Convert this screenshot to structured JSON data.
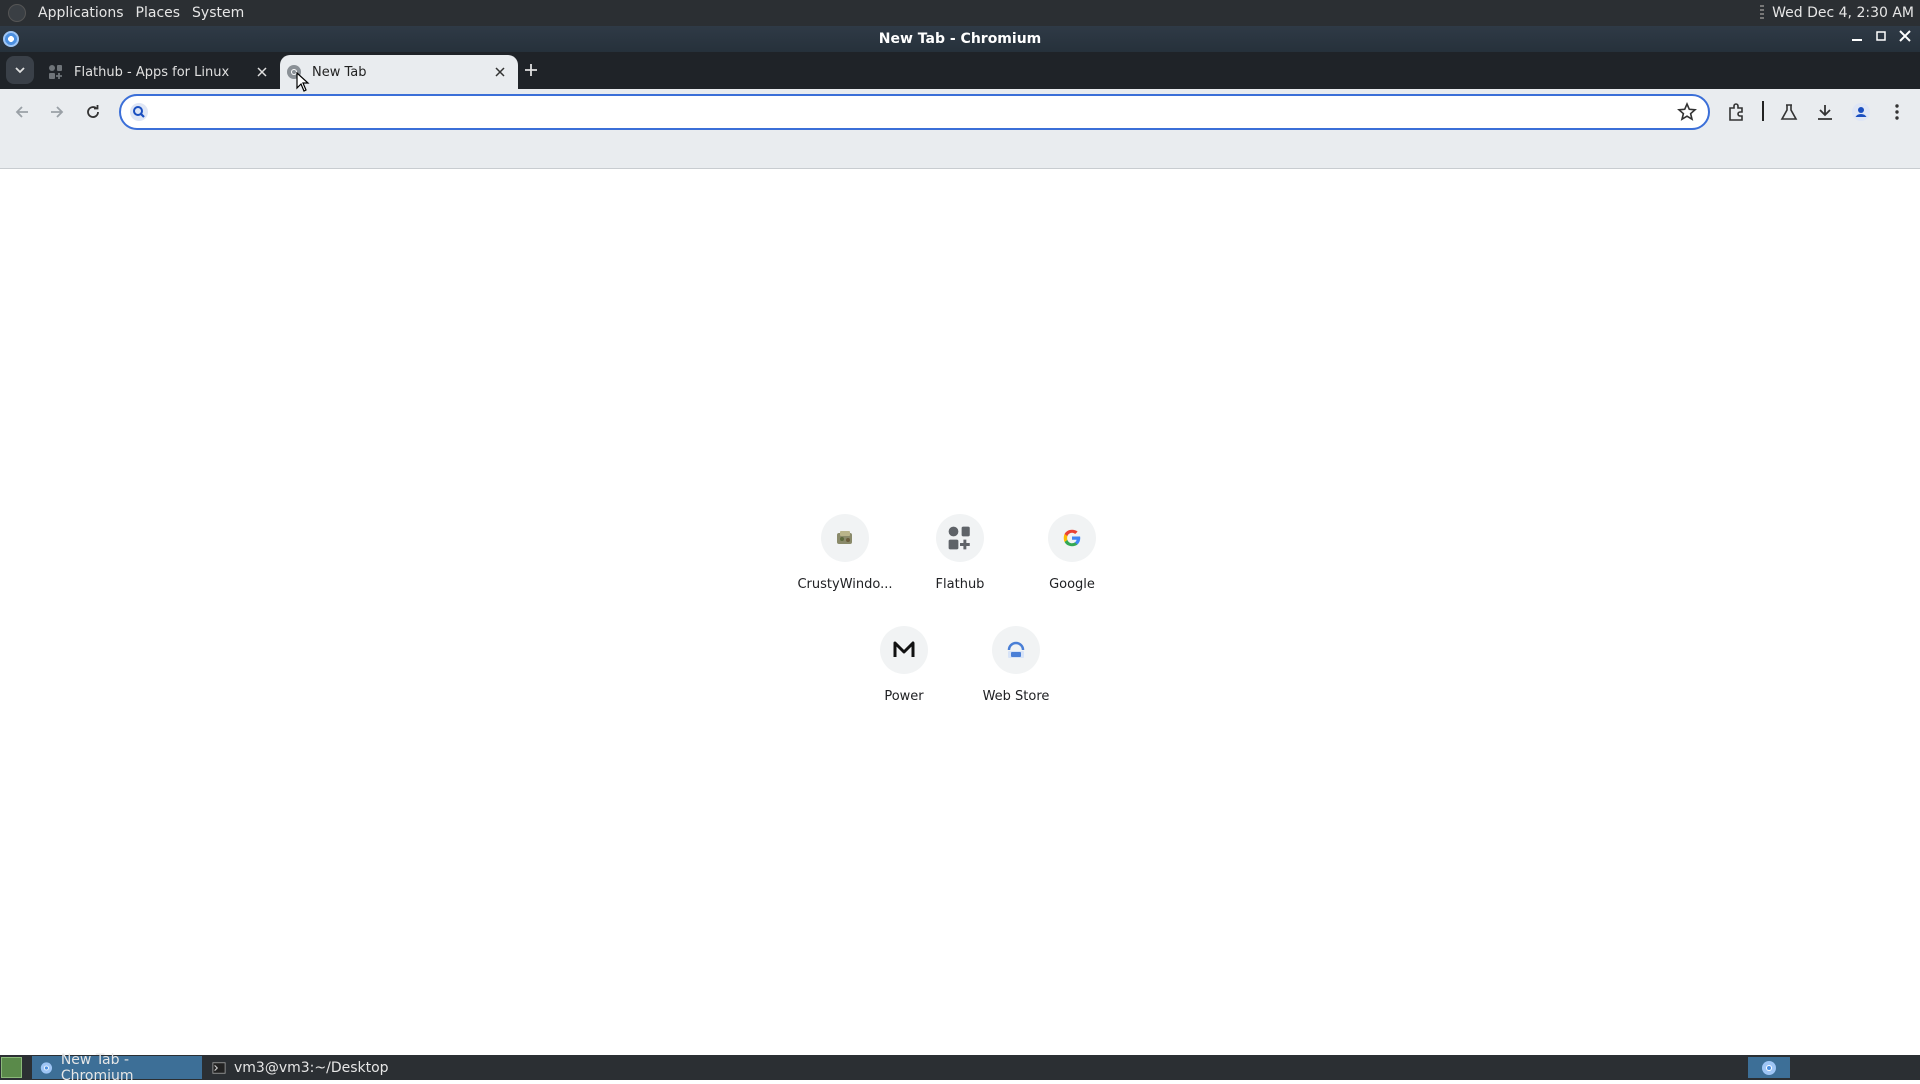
{
  "top_panel": {
    "menus": [
      "Applications",
      "Places",
      "System"
    ],
    "clock": "Wed Dec  4,  2:30 AM"
  },
  "window": {
    "title": "New Tab - Chromium"
  },
  "tabs": [
    {
      "label": "Flathub - Apps for Linux",
      "active": false
    },
    {
      "label": "New Tab",
      "active": true
    }
  ],
  "omnibox": {
    "value": "",
    "placeholder": ""
  },
  "shortcuts": [
    {
      "label": "CrustyWindo...",
      "icon": "crustywindows-icon"
    },
    {
      "label": "Flathub",
      "icon": "flathub-icon"
    },
    {
      "label": "Google",
      "icon": "google-icon"
    },
    {
      "label": "Power",
      "icon": "power-icon"
    },
    {
      "label": "Web Store",
      "icon": "web-store-icon"
    }
  ],
  "taskbar": {
    "tasks": [
      {
        "label": "New Tab - Chromium",
        "active": true
      },
      {
        "label": "vm3@vm3:~/Desktop",
        "active": false
      }
    ]
  },
  "colors": {
    "accent": "#3b6fd8",
    "panel": "#2b2f33",
    "toolbar": "#e9ecef"
  }
}
